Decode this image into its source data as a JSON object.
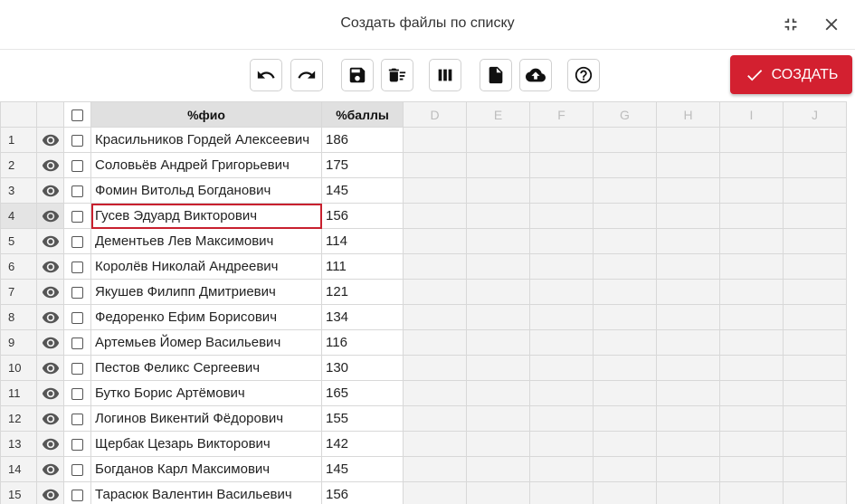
{
  "window": {
    "title": "Создать файлы по списку"
  },
  "toolbar": {
    "tools": [
      {
        "name": "undo-button",
        "icon": "undo-icon"
      },
      {
        "name": "redo-button",
        "icon": "redo-icon"
      },
      {
        "name": "save-button",
        "icon": "save-icon"
      },
      {
        "name": "delete-rows-button",
        "icon": "delete-sweep-icon"
      },
      {
        "name": "columns-button",
        "icon": "columns-icon"
      },
      {
        "name": "file-button",
        "icon": "file-icon"
      },
      {
        "name": "upload-button",
        "icon": "cloud-upload-icon"
      },
      {
        "name": "help-button",
        "icon": "help-icon"
      }
    ],
    "create_label": "СОЗДАТЬ"
  },
  "grid": {
    "columns": [
      "%фио",
      "%баллы",
      "D",
      "E",
      "F",
      "G",
      "H",
      "I",
      "J"
    ],
    "selected_row": 4,
    "rows": [
      {
        "num": "1",
        "name": "Красильников Гордей Алексеевич",
        "score": "186"
      },
      {
        "num": "2",
        "name": "Соловьёв Андрей Григорьевич",
        "score": "175"
      },
      {
        "num": "3",
        "name": "Фомин Витольд Богданович",
        "score": "145"
      },
      {
        "num": "4",
        "name": "Гусев Эдуард Викторович",
        "score": "156"
      },
      {
        "num": "5",
        "name": "Дементьев Лев Максимович",
        "score": "114"
      },
      {
        "num": "6",
        "name": "Королёв Николай Андреевич",
        "score": "111"
      },
      {
        "num": "7",
        "name": "Якушев Филипп Дмитриевич",
        "score": "121"
      },
      {
        "num": "8",
        "name": "Федоренко Ефим Борисович",
        "score": "134"
      },
      {
        "num": "9",
        "name": "Артемьев Йомер Васильевич",
        "score": "116"
      },
      {
        "num": "10",
        "name": "Пестов Феликс Сергеевич",
        "score": "130"
      },
      {
        "num": "11",
        "name": "Бутко Борис Артёмович",
        "score": "165"
      },
      {
        "num": "12",
        "name": "Логинов Викентий Фёдорович",
        "score": "155"
      },
      {
        "num": "13",
        "name": "Щербак Цезарь Викторович",
        "score": "142"
      },
      {
        "num": "14",
        "name": "Богданов Карл Максимович",
        "score": "145"
      },
      {
        "num": "15",
        "name": "Тарасюк Валентин Васильевич",
        "score": "156"
      }
    ]
  }
}
